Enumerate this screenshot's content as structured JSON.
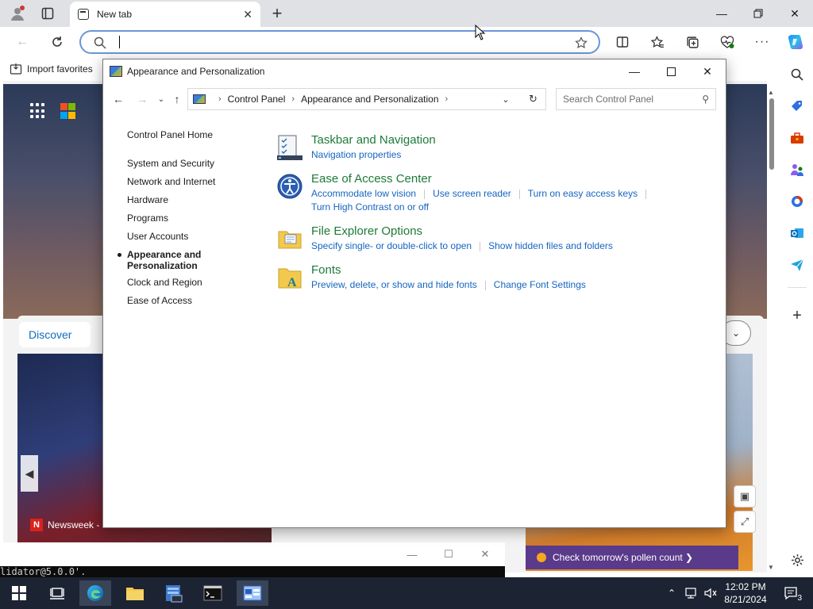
{
  "browser": {
    "tab_title": "New tab",
    "favorites_import_label": "Import favorites",
    "address_value": ""
  },
  "ntp": {
    "discover_label": "Discover",
    "news_source": "Newsweek - ...",
    "news_source_logo": "N",
    "pollen_label": "Check tomorrow's pollen count ❯"
  },
  "console": {
    "line": "lidator@5.0.0'."
  },
  "control_panel": {
    "window_title": "Appearance and Personalization",
    "breadcrumb": [
      "Control Panel",
      "Appearance and Personalization"
    ],
    "search_placeholder": "Search Control Panel",
    "left_nav": {
      "home": "Control Panel Home",
      "items": [
        {
          "label": "System and Security"
        },
        {
          "label": "Network and Internet"
        },
        {
          "label": "Hardware"
        },
        {
          "label": "Programs"
        },
        {
          "label": "User Accounts"
        },
        {
          "label": "Appearance and Personalization",
          "active": true
        },
        {
          "label": "Clock and Region"
        },
        {
          "label": "Ease of Access"
        }
      ]
    },
    "categories": [
      {
        "title": "Taskbar and Navigation",
        "icon": "taskbar-icon",
        "links": [
          "Navigation properties"
        ]
      },
      {
        "title": "Ease of Access Center",
        "icon": "ease-of-access-icon",
        "links": [
          "Accommodate low vision",
          "Use screen reader",
          "Turn on easy access keys"
        ],
        "links2": [
          "Turn High Contrast on or off"
        ]
      },
      {
        "title": "File Explorer Options",
        "icon": "folder-options-icon",
        "links": [
          "Specify single- or double-click to open",
          "Show hidden files and folders"
        ]
      },
      {
        "title": "Fonts",
        "icon": "fonts-folder-icon",
        "links": [
          "Preview, delete, or show and hide fonts",
          "Change Font Settings"
        ]
      }
    ]
  },
  "taskbar": {
    "time": "12:02 PM",
    "date": "8/21/2024",
    "notification_count": "3"
  },
  "colors": {
    "category_title": "#1e7a39",
    "link": "#1565c0",
    "taskbar_bg": "#1c2433"
  }
}
